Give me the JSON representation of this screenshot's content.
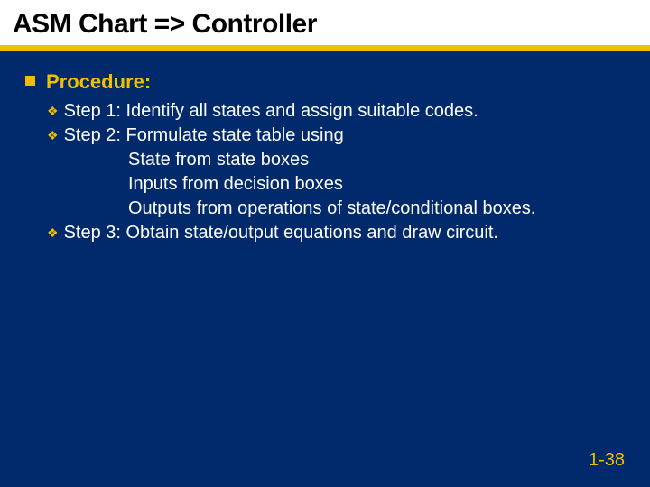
{
  "title": "ASM Chart => Controller",
  "heading": "Procedure:",
  "steps": {
    "s1": "Step 1: Identify all states and assign suitable codes.",
    "s2": "Step 2: Formulate state table using",
    "s2a": "State from state boxes",
    "s2b": "Inputs from decision boxes",
    "s2c": "Outputs from operations of state/conditional boxes.",
    "s3": "Step 3: Obtain state/output equations and draw circuit."
  },
  "slide_number": "1-38"
}
